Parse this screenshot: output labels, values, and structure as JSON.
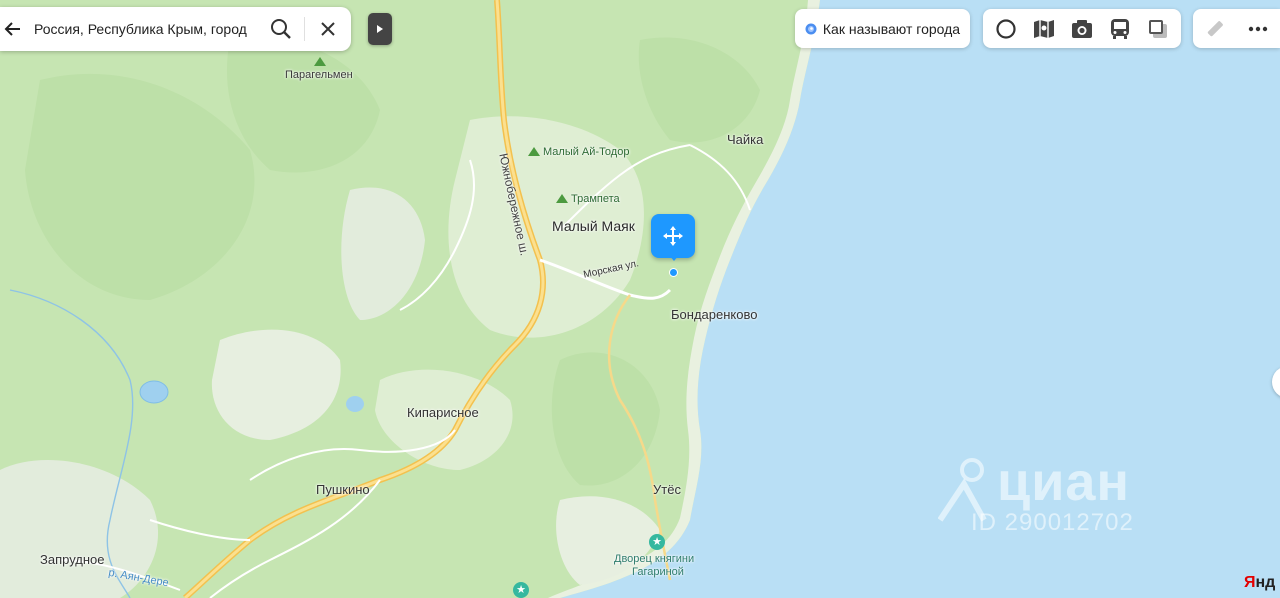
{
  "search": {
    "query": "Россия, Республика Крым, город",
    "back_icon": "arrow-left-icon",
    "search_icon": "search-icon",
    "clear_icon": "close-icon"
  },
  "panel": {
    "collapse_icon": "triangle-right-icon"
  },
  "city_names_button": {
    "label": "Как называют города",
    "icon": "spiral-icon"
  },
  "toolbar": {
    "items": [
      "circle-layer-icon",
      "map-layers-icon",
      "photo-camera-icon",
      "bus-icon",
      "map-style-icon"
    ],
    "extra": [
      "ruler-icon",
      "more-icon"
    ]
  },
  "map": {
    "places": [
      "Парагельмен",
      "Чайка",
      "Малый Маяк",
      "Бондаренково",
      "Кипарисное",
      "Пушкино",
      "Запрудное",
      "Утёс"
    ],
    "peaks": [
      "Малый Ай-Тодор",
      "Трампета"
    ],
    "streets": [
      "Морская ул.",
      "Южнобережное ш."
    ],
    "river": "р. Аян-Дере",
    "poi": [
      "Дворец княгини",
      "Гагариной"
    ]
  },
  "watermark": {
    "brand": "циан",
    "id_text": "ID 290012702"
  },
  "attribution": {
    "prefix": "Я",
    "rest": "нд"
  },
  "colors": {
    "sea": "#b9dff5",
    "forest": "#c9e6b8",
    "land": "#e4f0da",
    "road": "#f6c95b",
    "accent": "#1e98ff"
  }
}
